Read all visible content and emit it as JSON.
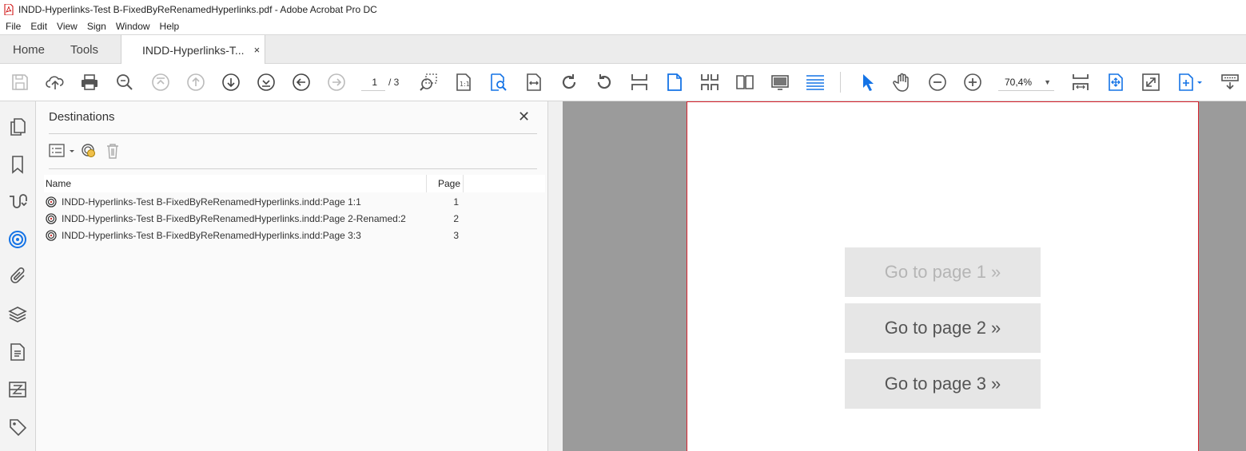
{
  "window": {
    "title": "INDD-Hyperlinks-Test B-FixedByReRenamedHyperlinks.pdf - Adobe Acrobat Pro DC"
  },
  "menu": [
    "File",
    "Edit",
    "View",
    "Sign",
    "Window",
    "Help"
  ],
  "tabs": {
    "home": "Home",
    "tools": "Tools",
    "document": "INDD-Hyperlinks-T...",
    "close": "×"
  },
  "toolbar": {
    "page_current": "1",
    "page_total": "/ 3",
    "zoom": "70,4%"
  },
  "panel": {
    "title": "Destinations",
    "close": "✕",
    "col_name": "Name",
    "col_page": "Page",
    "destinations": [
      {
        "name": "INDD-Hyperlinks-Test B-FixedByReRenamedHyperlinks.indd:Page 1:1",
        "page": "1"
      },
      {
        "name": "INDD-Hyperlinks-Test B-FixedByReRenamedHyperlinks.indd:Page 2-Renamed:2",
        "page": "2"
      },
      {
        "name": "INDD-Hyperlinks-Test B-FixedByReRenamedHyperlinks.indd:Page 3:3",
        "page": "3"
      }
    ]
  },
  "document": {
    "buttons": [
      {
        "label": "Go to page 1 »"
      },
      {
        "label": "Go to page 2 »"
      },
      {
        "label": "Go to page 3 »"
      }
    ]
  },
  "colors": {
    "accent_blue": "#1473e6",
    "page_border": "#d9232e",
    "doc_background": "#9b9b9b"
  }
}
